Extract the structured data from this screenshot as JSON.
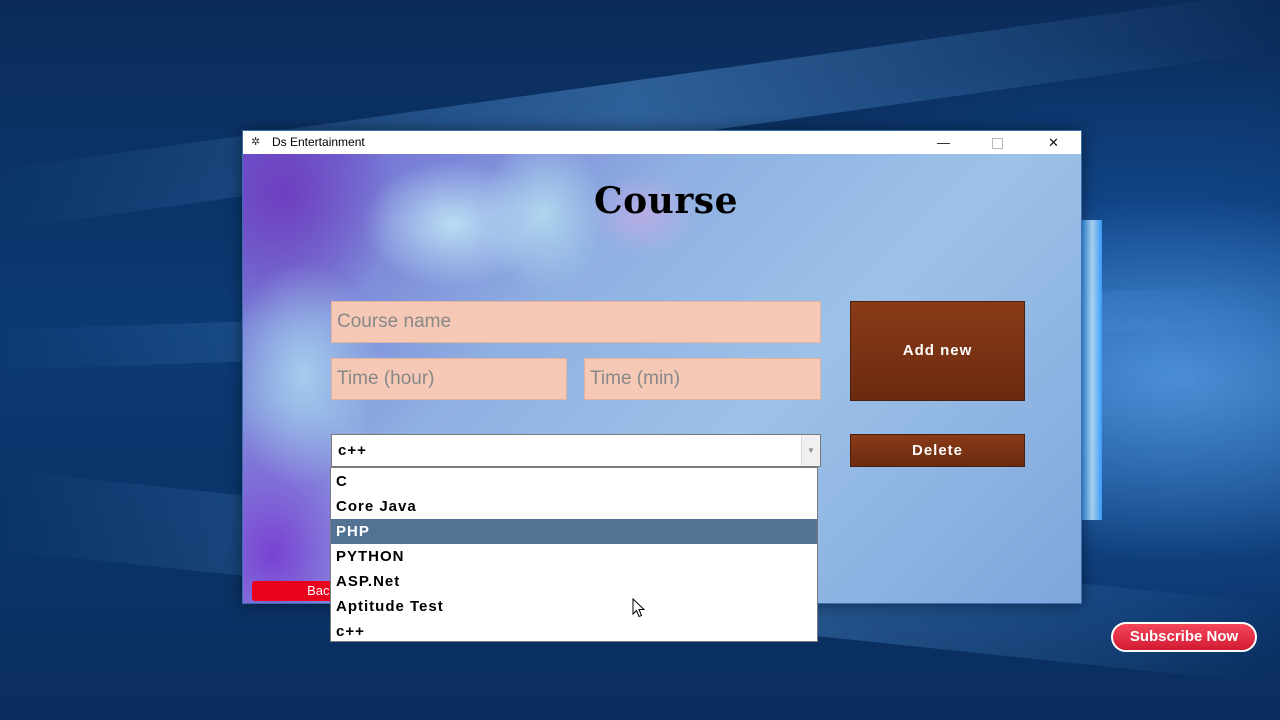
{
  "window": {
    "title": "Ds Entertainment",
    "app_icon": "app-logo-icon",
    "controls": {
      "minimize": "—",
      "maximize": "",
      "close": "✕"
    }
  },
  "form": {
    "heading": "Course",
    "course_name_placeholder": "Course name",
    "time_hour_placeholder": "Time (hour)",
    "time_min_placeholder": "Time (min)",
    "add_new_label": "Add new",
    "delete_label": "Delete",
    "back_label": "Back"
  },
  "combo": {
    "selected_value": "c++",
    "arrow_icon": "chevron-down-icon",
    "options": [
      "C",
      "Core Java",
      "PHP",
      "PYTHON",
      "ASP.Net",
      "Aptitude Test",
      "c++"
    ],
    "highlighted_index": 2
  },
  "overlay": {
    "subscribe_label": "Subscribe Now"
  },
  "colors": {
    "field_bg": "#f5c9b6",
    "button_brown": "#7a3213",
    "highlight": "#527393",
    "back_red": "#e8001c",
    "subscribe_red": "#e0283f"
  }
}
